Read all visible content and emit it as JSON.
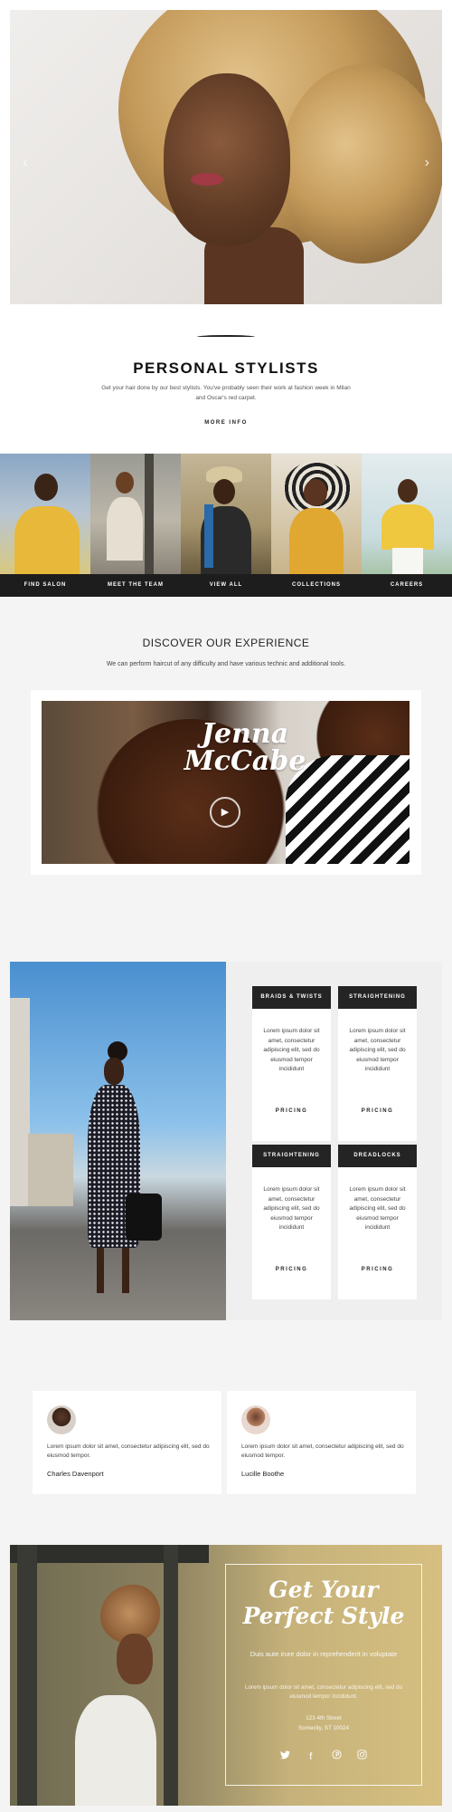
{
  "hero": {
    "prev_arrow": "‹",
    "next_arrow": "›"
  },
  "stylists": {
    "title": "PERSONAL STYLISTS",
    "description": "Get your hair done by our best stylists. You've probably seen their work at fashion week in Milan and Oscar's red carpet.",
    "more_info": "MORE INFO"
  },
  "gallery_nav": [
    "FIND SALON",
    "MEET THE TEAM",
    "VIEW ALL",
    "COLLECTIONS",
    "CAREERS"
  ],
  "discover": {
    "title": "DISCOVER OUR EXPERIENCE",
    "subtitle": "We can perform haircut of any difficulty and have various technic and additional tools.",
    "video_name": "Jenna McCabe",
    "play_icon": "▶"
  },
  "services": [
    {
      "title": "BRAIDS & TWISTS",
      "body": "Lorem ipsum dolor sit amet, consectetur adipiscing elit, sed do eiusmod tempor incididunt",
      "link": "PRICING"
    },
    {
      "title": "STRAIGHTENING",
      "body": "Lorem ipsum dolor sit amet, consectetur adipiscing elit, sed do eiusmod tempor incididunt",
      "link": "PRICING"
    },
    {
      "title": "STRAIGHTENING",
      "body": "Lorem ipsum dolor sit amet, consectetur adipiscing elit, sed do eiusmod tempor incididunt",
      "link": "PRICING"
    },
    {
      "title": "DREADLOCKS",
      "body": "Lorem ipsum dolor sit amet, consectetur adipiscing elit, sed do eiusmod tempor incididunt",
      "link": "PRICING"
    }
  ],
  "testimonials": [
    {
      "quote": "Lorem ipsum dolor sit amet, consectetur adipiscing elit, sed do eiusmod tempor.",
      "name": "Charles Davenport"
    },
    {
      "quote": "Lorem ipsum dolor sit amet, consectetur adipiscing elit, sed do eiusmod tempor.",
      "name": "Lucille Boothe"
    }
  ],
  "cta": {
    "title": "Get Your Perfect Style",
    "tagline": "Duis aute irure dolor in reprehenderit in voluptate",
    "description": "Lorem ipsum dolor sit amet, consectetur adipiscing elit, sed do eiusmod tempor incididunt.",
    "address_line1": "123 4th Street",
    "address_line2": "Somecity, ST 10024",
    "social_icons": [
      "twitter-icon",
      "facebook-icon",
      "pinterest-icon",
      "instagram-icon"
    ],
    "social_glyphs": [
      "🐦",
      "f",
      "℗",
      "◎"
    ]
  }
}
